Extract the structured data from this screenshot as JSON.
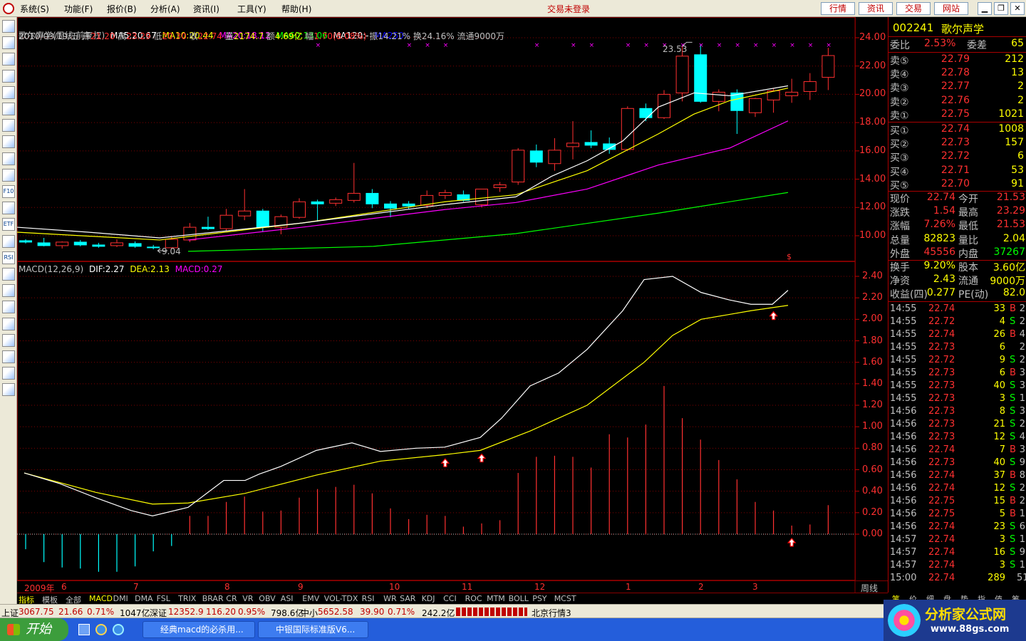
{
  "menu": {
    "items": [
      "系统(S)",
      "功能(F)",
      "报价(B)",
      "分析(A)",
      "资讯(I)",
      "工具(Y)",
      "帮助(H)"
    ],
    "status": "交易未登录",
    "right_buttons": [
      "行情",
      "资讯",
      "交易",
      "网站"
    ]
  },
  "toolbar": {
    "icons": [
      "home-icon",
      "list-icon",
      "grid-icon",
      "line-chart-icon",
      "candle-icon",
      "window-icon",
      "table-icon",
      "news-icon",
      "mail-icon",
      "people-icon",
      "f10-icon",
      "search-icon",
      "etf-icon",
      "wave-icon",
      "rsi-icon",
      "calc-icon",
      "dollar-icon",
      "wrench-icon",
      "export-icon",
      "pencil-icon",
      "move-icon",
      "up-arrow-icon",
      "down-arrow-icon"
    ],
    "labels": {
      "etf-icon": "ETF",
      "rsi-icon": "RSI",
      "f10-icon": "F10"
    }
  },
  "chart": {
    "header": {
      "name": "歌尔声学(周线,前复权)",
      "ma5": "MA5:20.67",
      "ma10": "MA10:20.44",
      "ma20": "MA20:18.12",
      "ma60": "MA60:13.06",
      "ma120": "MA120:-",
      "ma250": "MA250:-"
    },
    "info": {
      "date": "2010/03/19/五",
      "open_label": "开",
      "open": "21.20",
      "high_label": "高",
      "high": "23.29",
      "low_label": "低",
      "low": "20.30",
      "close_label": "收",
      "close": "22.74",
      "vol_label": "量",
      "vol": "2174.7",
      "amt_label": "额",
      "amt": "4.69亿",
      "chg_label": "幅",
      "chg": "1.70(8.08%)",
      "amp": "振14.21%",
      "turnover": "换24.16%",
      "float": "流通9000万"
    },
    "high_label": "23.53",
    "low_label": "9.04",
    "dollar": "$",
    "macd_header": {
      "title": "MACD(12,26,9)",
      "dif": "DIF:2.27",
      "dea": "DEA:2.13",
      "macd": "MACD:0.27"
    },
    "price_ticks": [
      "24.00",
      "22.00",
      "20.00",
      "18.00",
      "16.00",
      "14.00",
      "12.00",
      "10.00"
    ],
    "macd_ticks": [
      "2.40",
      "2.20",
      "2.00",
      "1.80",
      "1.60",
      "1.40",
      "1.20",
      "1.00",
      "0.80",
      "0.60",
      "0.40",
      "0.20",
      "0.00"
    ],
    "xaxis": {
      "year": "2009年",
      "months": [
        "6",
        "7",
        "8",
        "9",
        "10",
        "11",
        "12",
        "1",
        "2",
        "3"
      ],
      "period": "周线"
    }
  },
  "chart_data": {
    "type": "candlestick",
    "ylim": [
      8.4,
      24.6
    ],
    "macd_ylim": [
      -0.38,
      2.52
    ],
    "candles": [
      {
        "o": 9.65,
        "h": 9.75,
        "l": 9.45,
        "c": 9.55
      },
      {
        "o": 9.5,
        "h": 9.85,
        "l": 9.25,
        "c": 9.3
      },
      {
        "o": 9.3,
        "h": 9.6,
        "l": 9.1,
        "c": 9.55
      },
      {
        "o": 9.55,
        "h": 9.7,
        "l": 9.25,
        "c": 9.35
      },
      {
        "o": 9.35,
        "h": 9.5,
        "l": 9.15,
        "c": 9.25
      },
      {
        "o": 9.3,
        "h": 9.75,
        "l": 9.2,
        "c": 9.5
      },
      {
        "o": 9.45,
        "h": 9.6,
        "l": 9.15,
        "c": 9.25
      },
      {
        "o": 9.2,
        "h": 9.35,
        "l": 9.04,
        "c": 9.15
      },
      {
        "o": 9.15,
        "h": 9.9,
        "l": 9.05,
        "c": 9.75
      },
      {
        "o": 9.7,
        "h": 10.9,
        "l": 9.55,
        "c": 10.6
      },
      {
        "o": 10.6,
        "h": 11.35,
        "l": 10.4,
        "c": 10.5
      },
      {
        "o": 10.5,
        "h": 11.9,
        "l": 10.35,
        "c": 11.45
      },
      {
        "o": 11.4,
        "h": 13.3,
        "l": 11.1,
        "c": 11.75
      },
      {
        "o": 11.75,
        "h": 11.9,
        "l": 10.3,
        "c": 10.6
      },
      {
        "o": 10.6,
        "h": 11.5,
        "l": 10.1,
        "c": 11.35
      },
      {
        "o": 11.3,
        "h": 12.65,
        "l": 11.2,
        "c": 12.4
      },
      {
        "o": 12.4,
        "h": 12.55,
        "l": 11.0,
        "c": 12.25
      },
      {
        "o": 12.3,
        "h": 12.7,
        "l": 12.1,
        "c": 12.55
      },
      {
        "o": 12.5,
        "h": 15.15,
        "l": 12.35,
        "c": 13.0
      },
      {
        "o": 13.0,
        "h": 13.3,
        "l": 11.95,
        "c": 12.25
      },
      {
        "o": 12.25,
        "h": 12.45,
        "l": 11.3,
        "c": 11.95
      },
      {
        "o": 12.25,
        "h": 12.45,
        "l": 11.9,
        "c": 12.1
      },
      {
        "o": 12.15,
        "h": 13.2,
        "l": 11.95,
        "c": 12.85
      },
      {
        "o": 12.85,
        "h": 13.25,
        "l": 12.6,
        "c": 13.05
      },
      {
        "o": 12.9,
        "h": 13.2,
        "l": 12.4,
        "c": 12.5
      },
      {
        "o": 12.2,
        "h": 13.1,
        "l": 12.0,
        "c": 13.3
      },
      {
        "o": 13.4,
        "h": 13.8,
        "l": 13.1,
        "c": 13.6
      },
      {
        "o": 13.8,
        "h": 16.2,
        "l": 13.6,
        "c": 16.05
      },
      {
        "o": 16.0,
        "h": 16.45,
        "l": 14.85,
        "c": 15.2
      },
      {
        "o": 15.1,
        "h": 16.9,
        "l": 14.6,
        "c": 16.05
      },
      {
        "o": 16.3,
        "h": 18.1,
        "l": 15.4,
        "c": 16.55
      },
      {
        "o": 16.6,
        "h": 17.45,
        "l": 16.2,
        "c": 16.4
      },
      {
        "o": 16.5,
        "h": 16.95,
        "l": 15.8,
        "c": 16.1
      },
      {
        "o": 16.1,
        "h": 19.15,
        "l": 16.0,
        "c": 19.0
      },
      {
        "o": 19.0,
        "h": 19.35,
        "l": 18.1,
        "c": 18.35
      },
      {
        "o": 18.35,
        "h": 20.3,
        "l": 18.25,
        "c": 20.0
      },
      {
        "o": 20.1,
        "h": 23.4,
        "l": 19.5,
        "c": 22.7
      },
      {
        "o": 22.8,
        "h": 23.53,
        "l": 19.4,
        "c": 19.5
      },
      {
        "o": 19.5,
        "h": 20.35,
        "l": 18.8,
        "c": 20.15
      },
      {
        "o": 20.1,
        "h": 20.35,
        "l": 17.2,
        "c": 18.85
      },
      {
        "o": 18.7,
        "h": 19.75,
        "l": 18.4,
        "c": 19.7
      },
      {
        "o": 19.6,
        "h": 20.4,
        "l": 18.7,
        "c": 20.25
      },
      {
        "o": 19.9,
        "h": 21.1,
        "l": 19.4,
        "c": 20.15
      },
      {
        "o": 20.2,
        "h": 21.5,
        "l": 19.6,
        "c": 20.9
      },
      {
        "o": 21.2,
        "h": 23.29,
        "l": 20.3,
        "c": 22.74
      }
    ],
    "ma5": [
      [
        0,
        10.6
      ],
      [
        100,
        10.25
      ],
      [
        200,
        9.85
      ],
      [
        400,
        10.9
      ],
      [
        600,
        12.2
      ],
      [
        700,
        12.75
      ],
      [
        750,
        14.2
      ],
      [
        800,
        15.3
      ],
      [
        850,
        16.7
      ],
      [
        900,
        19.1
      ],
      [
        950,
        20.1
      ],
      [
        1000,
        19.9
      ],
      [
        1082,
        20.6
      ]
    ],
    "ma10": [
      [
        0,
        10.25
      ],
      [
        200,
        9.7
      ],
      [
        400,
        10.9
      ],
      [
        600,
        12.4
      ],
      [
        700,
        12.9
      ],
      [
        800,
        14.6
      ],
      [
        900,
        17.2
      ],
      [
        950,
        18.6
      ],
      [
        1000,
        19.55
      ],
      [
        1082,
        20.44
      ]
    ],
    "ma20": [
      [
        240,
        9.7
      ],
      [
        400,
        10.6
      ],
      [
        600,
        11.85
      ],
      [
        700,
        12.35
      ],
      [
        800,
        13.3
      ],
      [
        900,
        15.0
      ],
      [
        1000,
        16.2
      ],
      [
        1082,
        18.12
      ]
    ],
    "ma60": [
      [
        240,
        8.9
      ],
      [
        500,
        9.25
      ],
      [
        700,
        10.15
      ],
      [
        900,
        11.6
      ],
      [
        1082,
        13.06
      ]
    ],
    "dif": [
      [
        10,
        0.57
      ],
      [
        60,
        0.47
      ],
      [
        110,
        0.34
      ],
      [
        160,
        0.22
      ],
      [
        190,
        0.17
      ],
      [
        240,
        0.25
      ],
      [
        290,
        0.5
      ],
      [
        320,
        0.5
      ],
      [
        340,
        0.56
      ],
      [
        370,
        0.63
      ],
      [
        420,
        0.78
      ],
      [
        470,
        0.85
      ],
      [
        510,
        0.77
      ],
      [
        560,
        0.8
      ],
      [
        600,
        0.81
      ],
      [
        650,
        0.9
      ],
      [
        680,
        1.08
      ],
      [
        720,
        1.38
      ],
      [
        760,
        1.5
      ],
      [
        800,
        1.72
      ],
      [
        850,
        2.08
      ],
      [
        880,
        2.37
      ],
      [
        920,
        2.4
      ],
      [
        960,
        2.25
      ],
      [
        1000,
        2.18
      ],
      [
        1030,
        2.14
      ],
      [
        1060,
        2.14
      ],
      [
        1082,
        2.27
      ]
    ],
    "dea": [
      [
        10,
        0.57
      ],
      [
        110,
        0.39
      ],
      [
        190,
        0.28
      ],
      [
        240,
        0.29
      ],
      [
        320,
        0.38
      ],
      [
        420,
        0.55
      ],
      [
        510,
        0.68
      ],
      [
        600,
        0.74
      ],
      [
        650,
        0.78
      ],
      [
        720,
        0.96
      ],
      [
        800,
        1.2
      ],
      [
        880,
        1.6
      ],
      [
        920,
        1.85
      ],
      [
        960,
        2.0
      ],
      [
        1030,
        2.08
      ],
      [
        1082,
        2.13
      ]
    ],
    "macd": [
      -0.14,
      -0.26,
      -0.31,
      -0.32,
      -0.35,
      -0.35,
      -0.3,
      -0.16,
      -0.11,
      0.17,
      0.17,
      0.3,
      0.35,
      0.21,
      0.22,
      0.34,
      0.42,
      0.44,
      0.46,
      0.38,
      0.24,
      0.14,
      0.18,
      0.17,
      0.07,
      0.1,
      0.13,
      0.57,
      0.72,
      0.73,
      0.72,
      0.62,
      0.93,
      0.9,
      1.02,
      1.38,
      1.08,
      0.88,
      0.69,
      0.51,
      0.3,
      0.22,
      0.08,
      0.09,
      0.27
    ],
    "crosses": [
      16,
      21,
      22,
      23,
      28,
      30,
      31,
      33,
      34,
      35,
      36,
      37,
      38,
      39,
      40,
      41,
      42,
      43,
      44
    ],
    "price_arrows": [
      [
        23.53,
        36,
        "up"
      ],
      [
        9.04,
        7,
        "left"
      ]
    ],
    "macd_arrows": [
      23,
      25,
      41,
      42
    ]
  },
  "quote": {
    "code": "002241",
    "name": "歌尔声学",
    "weibi": {
      "label": "委比",
      "value": "2.53%",
      "label2": "委差",
      "value2": "65"
    },
    "sells": [
      {
        "label": "卖⑤",
        "price": "22.79",
        "vol": "212"
      },
      {
        "label": "卖④",
        "price": "22.78",
        "vol": "13"
      },
      {
        "label": "卖③",
        "price": "22.77",
        "vol": "2"
      },
      {
        "label": "卖②",
        "price": "22.76",
        "vol": "2"
      },
      {
        "label": "卖①",
        "price": "22.75",
        "vol": "1021"
      }
    ],
    "buys": [
      {
        "label": "买①",
        "price": "22.74",
        "vol": "1008"
      },
      {
        "label": "买②",
        "price": "22.73",
        "vol": "157"
      },
      {
        "label": "买③",
        "price": "22.72",
        "vol": "6"
      },
      {
        "label": "买④",
        "price": "22.71",
        "vol": "53"
      },
      {
        "label": "买⑤",
        "price": "22.70",
        "vol": "91"
      }
    ],
    "stats": [
      {
        "l1": "现价",
        "v1": "22.74",
        "l2": "今开",
        "v2": "21.53",
        "c1": "#ff3030",
        "c2": "#ff3030"
      },
      {
        "l1": "涨跌",
        "v1": "1.54",
        "l2": "最高",
        "v2": "23.29",
        "c1": "#ff3030",
        "c2": "#ff3030"
      },
      {
        "l1": "涨幅",
        "v1": "7.26%",
        "l2": "最低",
        "v2": "21.53",
        "c1": "#ff3030",
        "c2": "#ff3030"
      },
      {
        "l1": "总量",
        "v1": "82823",
        "l2": "量比",
        "v2": "2.04",
        "c1": "#ffff00",
        "c2": "#ffff00"
      },
      {
        "l1": "外盘",
        "v1": "45556",
        "l2": "内盘",
        "v2": "37267",
        "c1": "#ff3030",
        "c2": "#00ff00"
      },
      {
        "l1": "换手",
        "v1": "9.20%",
        "l2": "股本",
        "v2": "3.60亿",
        "c1": "#ffff00",
        "c2": "#ffff00"
      },
      {
        "l1": "净资",
        "v1": "2.43",
        "l2": "流通",
        "v2": "9000万",
        "c1": "#ffff00",
        "c2": "#ffff00"
      },
      {
        "l1": "收益(四)",
        "v1": "0.277",
        "l2": "PE(动)",
        "v2": "82.0",
        "c1": "#ffff00",
        "c2": "#ffff00"
      }
    ],
    "ticks": [
      [
        "14:55",
        "22.74",
        "33",
        "B",
        "2"
      ],
      [
        "14:55",
        "22.72",
        "4",
        "S",
        "2"
      ],
      [
        "14:55",
        "22.74",
        "26",
        "B",
        "4"
      ],
      [
        "14:55",
        "22.73",
        "6",
        "",
        "2"
      ],
      [
        "14:55",
        "22.72",
        "9",
        "S",
        "2"
      ],
      [
        "14:55",
        "22.73",
        "6",
        "B",
        "3"
      ],
      [
        "14:55",
        "22.73",
        "40",
        "S",
        "3"
      ],
      [
        "14:55",
        "22.73",
        "3",
        "S",
        "1"
      ],
      [
        "14:56",
        "22.73",
        "8",
        "S",
        "3"
      ],
      [
        "14:56",
        "22.73",
        "21",
        "S",
        "2"
      ],
      [
        "14:56",
        "22.73",
        "12",
        "S",
        "4"
      ],
      [
        "14:56",
        "22.74",
        "7",
        "B",
        "3"
      ],
      [
        "14:56",
        "22.73",
        "40",
        "S",
        "9"
      ],
      [
        "14:56",
        "22.74",
        "37",
        "B",
        "8"
      ],
      [
        "14:56",
        "22.74",
        "12",
        "S",
        "2"
      ],
      [
        "14:56",
        "22.75",
        "15",
        "B",
        "2"
      ],
      [
        "14:56",
        "22.75",
        "5",
        "B",
        "1"
      ],
      [
        "14:56",
        "22.74",
        "23",
        "S",
        "6"
      ],
      [
        "14:57",
        "22.74",
        "3",
        "S",
        "1"
      ],
      [
        "14:57",
        "22.74",
        "16",
        "S",
        "9"
      ],
      [
        "14:57",
        "22.74",
        "3",
        "S",
        "1"
      ],
      [
        "15:00",
        "22.74",
        "289",
        "",
        "51"
      ]
    ],
    "tabs": [
      "笔",
      "价",
      "细",
      "盘",
      "势",
      "指",
      "值",
      "筹"
    ]
  },
  "indicator_tabs": [
    "指标",
    "模板",
    "全部",
    "MACD",
    "DMI",
    "DMA",
    "FSL",
    "TRIX",
    "BRAR",
    "CR",
    "VR",
    "OBV",
    "ASI",
    "EMV",
    "VOL-TDX",
    "RSI",
    "WR",
    "SAR",
    "KDJ",
    "CCI",
    "ROC",
    "MTM",
    "BOLL",
    "PSY",
    "MCST"
  ],
  "indexbar": {
    "sh": {
      "label": "上证",
      "value": "3067.75",
      "chg": "21.66",
      "pct": "0.71%",
      "amt": "1047亿"
    },
    "sz": {
      "label": "深证",
      "value": "12352.9",
      "chg": "116.20",
      "pct": "0.95%",
      "amt": "798.6亿"
    },
    "zx": {
      "label": "中小",
      "value": "5652.58",
      "chg": "39.90",
      "pct": "0.71%",
      "amt": "242.2亿"
    },
    "server": "北京行情3"
  },
  "taskbar": {
    "start": "开始",
    "items": [
      "经典macd的必杀用...",
      "中银国际标准版V6..."
    ]
  },
  "watermark": {
    "title": "分析家公式网",
    "url": "www.88gs.com"
  },
  "colors": {
    "up": "#ff3030",
    "down": "#00ffff",
    "ma5": "#ffffff",
    "ma10": "#ffff00",
    "ma20": "#ff00ff",
    "ma60": "#00ff00",
    "ma250": "#0000ff",
    "grid": "#800000"
  }
}
